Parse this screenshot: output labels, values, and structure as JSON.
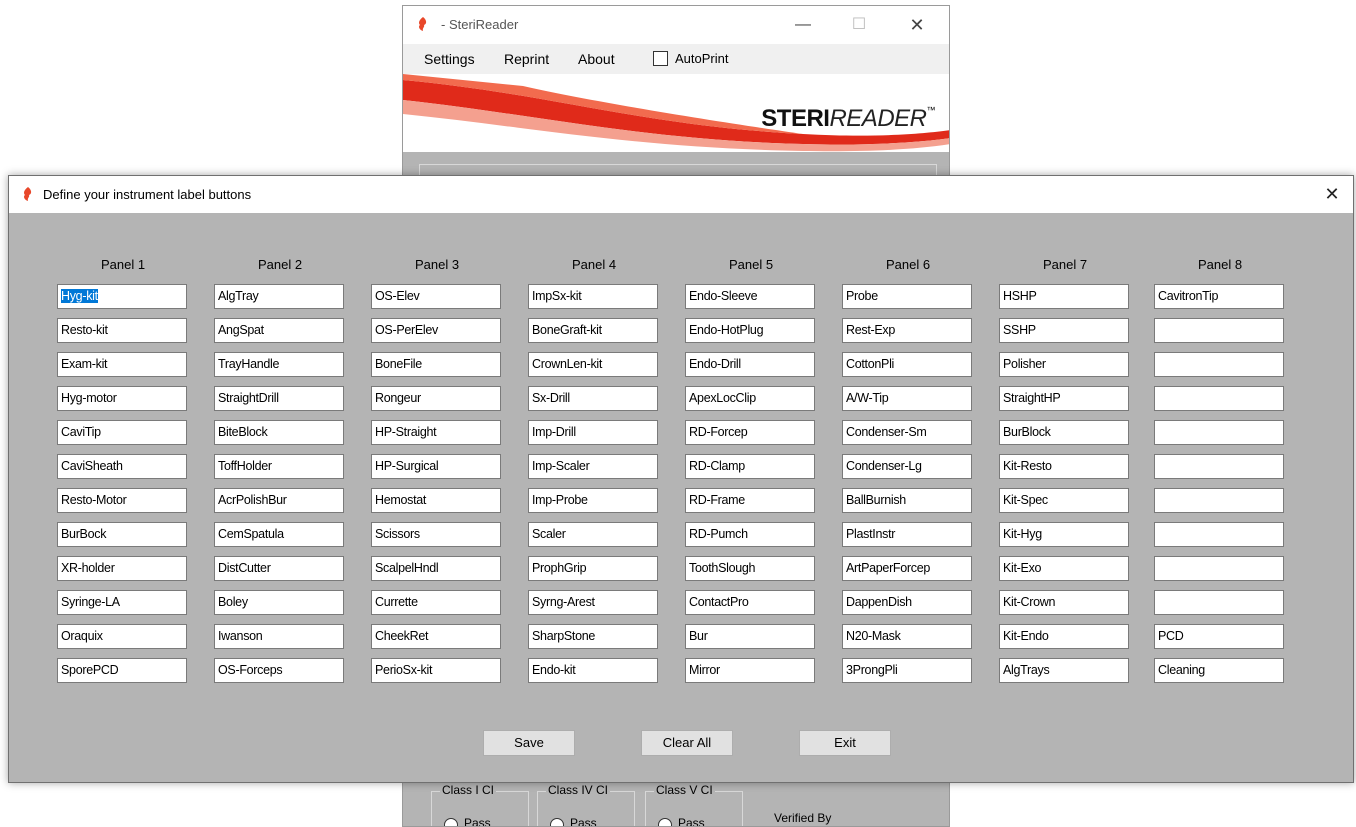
{
  "main_window": {
    "title": "- SteriReader",
    "controls": {
      "minimize": "—",
      "maximize": "☐",
      "close": "✕"
    },
    "menu": {
      "settings": "Settings",
      "reprint": "Reprint",
      "about": "About"
    },
    "autoprint_label": "AutoPrint",
    "autoprint_checked": false,
    "brand": {
      "bold": "STERI",
      "light": "READER",
      "tm": "™"
    },
    "class_groups": [
      {
        "title": "Class I CI",
        "option": "Pass"
      },
      {
        "title": "Class IV CI",
        "option": "Pass"
      },
      {
        "title": "Class V CI",
        "option": "Pass"
      }
    ],
    "verified_label": "Verified By"
  },
  "dialog": {
    "title": "Define your instrument label buttons",
    "close": "✕",
    "panels": [
      {
        "header": "Panel 1",
        "items": [
          "Hyg-kit",
          "Resto-kit",
          "Exam-kit",
          "Hyg-motor",
          "CaviTip",
          "CaviSheath",
          "Resto-Motor",
          "BurBock",
          "XR-holder",
          "Syringe-LA",
          "Oraquix",
          "SporePCD"
        ]
      },
      {
        "header": "Panel 2",
        "items": [
          "AlgTray",
          "AngSpat",
          "TrayHandle",
          "StraightDrill",
          "BiteBlock",
          "ToffHolder",
          "AcrPolishBur",
          "CemSpatula",
          "DistCutter",
          "Boley",
          "Iwanson",
          "OS-Forceps"
        ]
      },
      {
        "header": "Panel 3",
        "items": [
          "OS-Elev",
          "OS-PerElev",
          "BoneFile",
          "Rongeur",
          "HP-Straight",
          "HP-Surgical",
          "Hemostat",
          "Scissors",
          "ScalpelHndl",
          "Currette",
          "CheekRet",
          "PerioSx-kit"
        ]
      },
      {
        "header": "Panel 4",
        "items": [
          "ImpSx-kit",
          "BoneGraft-kit",
          "CrownLen-kit",
          "Sx-Drill",
          "Imp-Drill",
          "Imp-Scaler",
          "Imp-Probe",
          "Scaler",
          "ProphGrip",
          "Syrng-Arest",
          "SharpStone",
          "Endo-kit"
        ]
      },
      {
        "header": "Panel 5",
        "items": [
          "Endo-Sleeve",
          "Endo-HotPlug",
          "Endo-Drill",
          "ApexLocClip",
          "RD-Forcep",
          "RD-Clamp",
          "RD-Frame",
          "RD-Pumch",
          "ToothSlough",
          "ContactPro",
          "Bur",
          "Mirror"
        ]
      },
      {
        "header": "Panel 6",
        "items": [
          "Probe",
          "Rest-Exp",
          "CottonPli",
          "A/W-Tip",
          "Condenser-Sm",
          "Condenser-Lg",
          "BallBurnish",
          "PlastInstr",
          "ArtPaperForcep",
          "DappenDish",
          "N20-Mask",
          "3ProngPli"
        ]
      },
      {
        "header": "Panel 7",
        "items": [
          "HSHP",
          "SSHP",
          "Polisher",
          "StraightHP",
          "BurBlock",
          "Kit-Resto",
          "Kit-Spec",
          "Kit-Hyg",
          "Kit-Exo",
          "Kit-Crown",
          "Kit-Endo",
          "AlgTrays"
        ]
      },
      {
        "header": "Panel 8",
        "items": [
          "CavitronTip",
          "",
          "",
          "",
          "",
          "",
          "",
          "",
          "",
          "",
          "PCD",
          "Cleaning"
        ]
      }
    ],
    "selected": {
      "panel": 0,
      "item": 0
    },
    "buttons": {
      "save": "Save",
      "clear_all": "Clear All",
      "exit": "Exit"
    }
  },
  "colors": {
    "background": "#b4b4b4",
    "selection": "#0078d7",
    "icon": "#e8472a",
    "banner_red": "#e02a1a"
  },
  "icons": {
    "app": "flame-logo-icon"
  }
}
